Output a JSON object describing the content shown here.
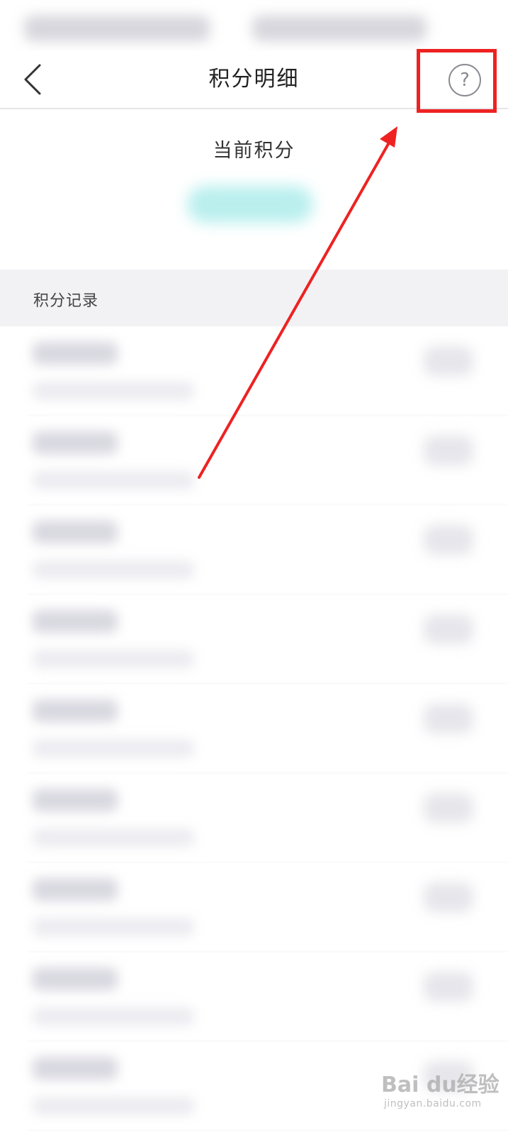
{
  "nav": {
    "back_icon": "chevron-left-icon",
    "title": "积分明细",
    "help_icon": "question-circle-icon",
    "help_glyph": "?"
  },
  "points": {
    "label": "当前积分"
  },
  "records": {
    "title": "积分记录",
    "item_count": 9
  },
  "annotation": {
    "color": "#ee2222"
  },
  "watermark": {
    "logo": "Bai du经验",
    "url": "jingyan.baidu.com"
  }
}
